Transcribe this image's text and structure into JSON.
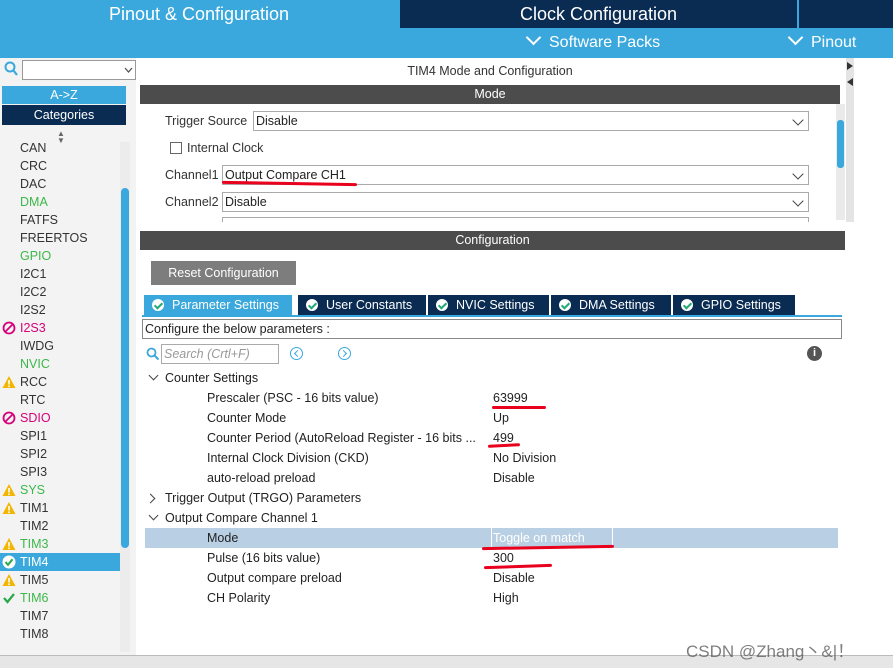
{
  "top_tabs": {
    "pinout": "Pinout & Configuration",
    "clock": "Clock Configuration"
  },
  "sub_menu": {
    "software_packs": "Software Packs",
    "pinout": "Pinout"
  },
  "left": {
    "sort_az": "A->Z",
    "categories": "Categories",
    "items": [
      {
        "label": "CAN",
        "color": "#333333",
        "icon": ""
      },
      {
        "label": "CRC",
        "color": "#333333",
        "icon": ""
      },
      {
        "label": "DAC",
        "color": "#333333",
        "icon": ""
      },
      {
        "label": "DMA",
        "color": "#3cb84a",
        "icon": ""
      },
      {
        "label": "FATFS",
        "color": "#333333",
        "icon": ""
      },
      {
        "label": "FREERTOS",
        "color": "#333333",
        "icon": ""
      },
      {
        "label": "GPIO",
        "color": "#3cb84a",
        "icon": ""
      },
      {
        "label": "I2C1",
        "color": "#333333",
        "icon": ""
      },
      {
        "label": "I2C2",
        "color": "#333333",
        "icon": ""
      },
      {
        "label": "I2S2",
        "color": "#333333",
        "icon": ""
      },
      {
        "label": "I2S3",
        "color": "#d6007a",
        "icon": "forbidden-icon"
      },
      {
        "label": "IWDG",
        "color": "#333333",
        "icon": ""
      },
      {
        "label": "NVIC",
        "color": "#3cb84a",
        "icon": ""
      },
      {
        "label": "RCC",
        "color": "#333333",
        "icon": "warning-icon"
      },
      {
        "label": "RTC",
        "color": "#333333",
        "icon": ""
      },
      {
        "label": "SDIO",
        "color": "#d6007a",
        "icon": "forbidden-icon"
      },
      {
        "label": "SPI1",
        "color": "#333333",
        "icon": ""
      },
      {
        "label": "SPI2",
        "color": "#333333",
        "icon": ""
      },
      {
        "label": "SPI3",
        "color": "#333333",
        "icon": ""
      },
      {
        "label": "SYS",
        "color": "#3cb84a",
        "icon": "warning-icon"
      },
      {
        "label": "TIM1",
        "color": "#333333",
        "icon": "warning-icon"
      },
      {
        "label": "TIM2",
        "color": "#333333",
        "icon": ""
      },
      {
        "label": "TIM3",
        "color": "#3cb84a",
        "icon": "warning-icon"
      },
      {
        "label": "TIM4",
        "color": "#ffffff",
        "icon": "check-circle-icon",
        "selected": true
      },
      {
        "label": "TIM5",
        "color": "#333333",
        "icon": "warning-icon"
      },
      {
        "label": "TIM6",
        "color": "#3cb84a",
        "icon": "check-icon"
      },
      {
        "label": "TIM7",
        "color": "#333333",
        "icon": ""
      },
      {
        "label": "TIM8",
        "color": "#333333",
        "icon": ""
      }
    ]
  },
  "mode_panel": {
    "title": "TIM4 Mode and Configuration",
    "header": "Mode",
    "trigger_source_label": "Trigger Source",
    "trigger_source_value": "Disable",
    "internal_clock_label": "Internal Clock",
    "channel1_label": "Channel1",
    "channel1_value": "Output Compare CH1",
    "channel2_label": "Channel2",
    "channel2_value": "Disable"
  },
  "config_panel": {
    "header": "Configuration",
    "reset_button": "Reset Configuration",
    "tabs": [
      {
        "label": "Parameter Settings",
        "active": true
      },
      {
        "label": "User Constants"
      },
      {
        "label": "NVIC Settings"
      },
      {
        "label": "DMA Settings"
      },
      {
        "label": "GPIO Settings"
      }
    ],
    "hint": "Configure the below parameters :",
    "search_placeholder": "Search (Crtl+F)",
    "counter_settings": "Counter Settings",
    "prescaler_label": "Prescaler (PSC - 16 bits value)",
    "prescaler_value": "63999",
    "counter_mode_label": "Counter Mode",
    "counter_mode_value": "Up",
    "counter_period_label": "Counter Period (AutoReload Register - 16 bits ...",
    "counter_period_value": "499",
    "clock_div_label": "Internal Clock Division (CKD)",
    "clock_div_value": "No Division",
    "autoreload_label": "auto-reload preload",
    "autoreload_value": "Disable",
    "trigger_output": "Trigger Output (TRGO) Parameters",
    "oc_channel1": "Output Compare Channel 1",
    "mode_label": "Mode",
    "mode_value": "Toggle on match",
    "pulse_label": "Pulse (16 bits value)",
    "pulse_value": "300",
    "oc_preload_label": "Output compare preload",
    "oc_preload_value": "Disable",
    "ch_polarity_label": "CH Polarity",
    "ch_polarity_value": "High"
  },
  "watermark": "CSDN @Zhang丶&|！"
}
